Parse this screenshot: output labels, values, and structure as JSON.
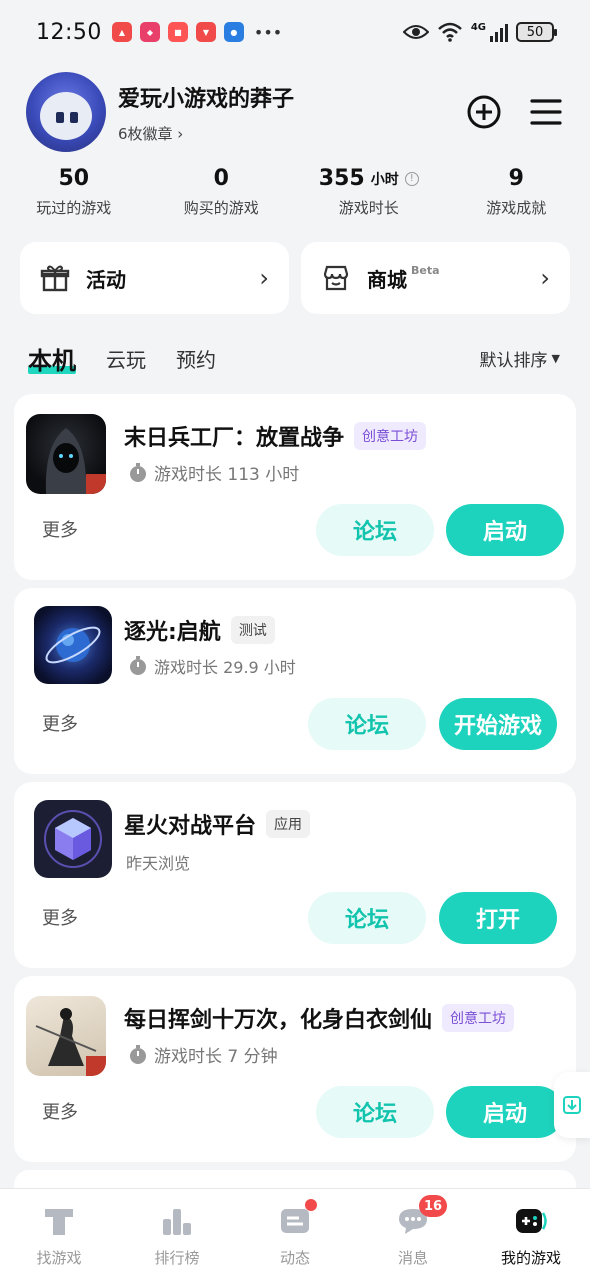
{
  "status_bar": {
    "time": "12:50",
    "network": "4G",
    "battery": "50"
  },
  "profile": {
    "username": "爱玩小游戏的莽子",
    "badges": "6枚徽章 ›"
  },
  "stats": [
    {
      "value": "50",
      "unit": "",
      "label": "玩过的游戏"
    },
    {
      "value": "0",
      "unit": "",
      "label": "购买的游戏"
    },
    {
      "value": "355",
      "unit": "小时",
      "label": "游戏时长"
    },
    {
      "value": "9",
      "unit": "",
      "label": "游戏成就"
    }
  ],
  "entries": {
    "activity": "活动",
    "mall": "商城",
    "mall_badge": "Beta",
    "arrow": "›"
  },
  "tabs": {
    "local": "本机",
    "cloud": "云玩",
    "reserve": "预约",
    "sort": "默认排序"
  },
  "games": [
    {
      "title": "末日兵工厂：放置战争",
      "tag": "创意工坊",
      "sub": "游戏时长 113 小时",
      "more": "更多",
      "forum": "论坛",
      "action": "启动"
    },
    {
      "title": "逐光:启航",
      "tag": "测试",
      "sub": "游戏时长 29.9 小时",
      "more": "更多",
      "forum": "论坛",
      "action": "开始游戏"
    },
    {
      "title": "星火对战平台",
      "tag": "应用",
      "sub": "昨天浏览",
      "more": "更多",
      "forum": "论坛",
      "action": "打开"
    },
    {
      "title": "每日挥剑十万次，化身白衣剑仙",
      "tag": "创意工坊",
      "sub": "游戏时长 7 分钟",
      "more": "更多",
      "forum": "论坛",
      "action": "启动"
    }
  ],
  "nav": [
    {
      "label": "找游戏"
    },
    {
      "label": "排行榜"
    },
    {
      "label": "动态"
    },
    {
      "label": "消息",
      "badge": "16"
    },
    {
      "label": "我的游戏"
    }
  ],
  "colors": {
    "accent": "#1ed3bd",
    "forum_bg": "#e6faf7",
    "tag_purple": "#7a4fd6",
    "badge_red": "#f24a4a"
  }
}
